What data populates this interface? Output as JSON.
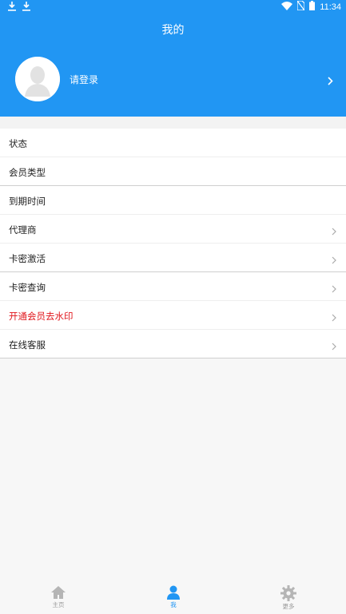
{
  "colors": {
    "accent": "#2196f3",
    "danger": "#e0151b"
  },
  "statusbar": {
    "time": "11:34",
    "icons": [
      "download-icon",
      "download-icon",
      "wifi-icon",
      "no-sim-icon",
      "battery-icon"
    ]
  },
  "header": {
    "title": "我的"
  },
  "profile": {
    "login_label": "请登录",
    "avatar_icon": "avatar-placeholder-icon"
  },
  "list": {
    "status": "状态",
    "member_type": "会员类型",
    "expiry": "到期时间",
    "agent": "代理商",
    "card_activate": "卡密激活",
    "card_query": "卡密查询",
    "vip_watermark": "开通会员去水印",
    "support": "在线客服"
  },
  "tabs": [
    {
      "label": "主页",
      "icon": "home-icon"
    },
    {
      "label": "我",
      "icon": "person-icon",
      "active": true
    },
    {
      "label": "更多",
      "icon": "gear-icon"
    }
  ]
}
